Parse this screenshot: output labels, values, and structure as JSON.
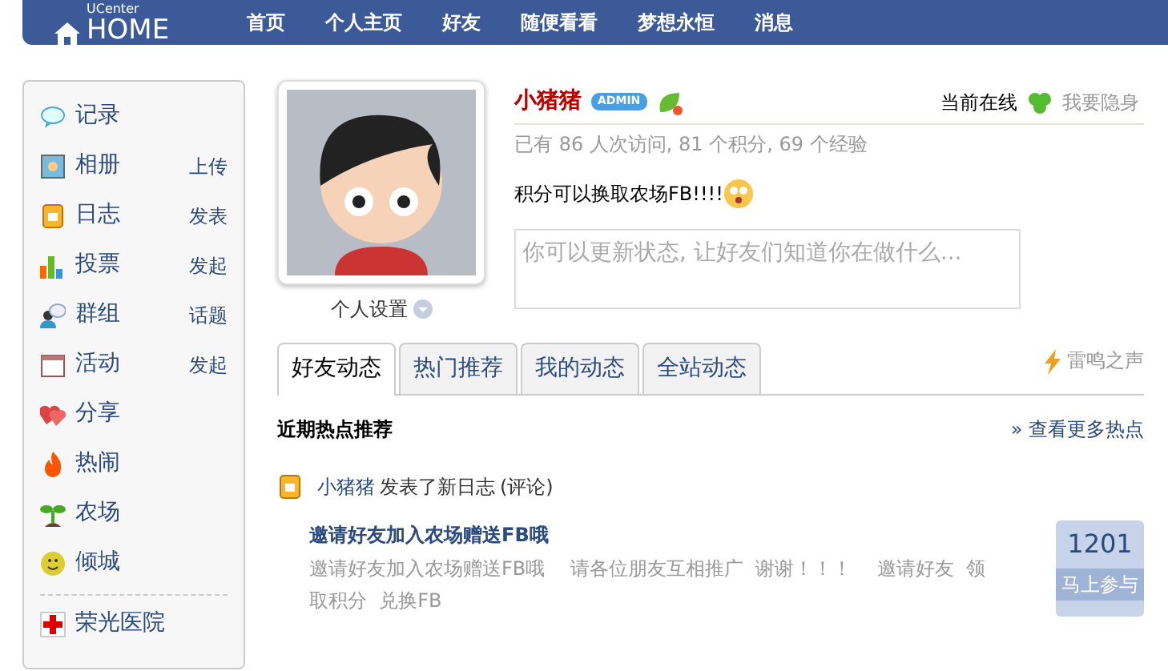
{
  "header": {
    "logo_small": "UCenter",
    "logo": "HOME",
    "nav": [
      {
        "label": "首页"
      },
      {
        "label": "个人主页"
      },
      {
        "label": "好友"
      },
      {
        "label": "随便看看"
      },
      {
        "label": "梦想永恒"
      },
      {
        "label": "消息"
      }
    ]
  },
  "sidebar": {
    "items": [
      {
        "kind": "record",
        "label": "记录"
      },
      {
        "kind": "album",
        "label": "相册",
        "action": "上传"
      },
      {
        "kind": "blog",
        "label": "日志",
        "action": "发表"
      },
      {
        "kind": "poll",
        "label": "投票",
        "action": "发起"
      },
      {
        "kind": "group",
        "label": "群组",
        "action": "话题"
      },
      {
        "kind": "event",
        "label": "活动",
        "action": "发起"
      },
      {
        "kind": "share",
        "label": "分享"
      },
      {
        "kind": "hot",
        "label": "热闹"
      },
      {
        "kind": "farm",
        "label": "农场"
      },
      {
        "kind": "city",
        "label": "倾城"
      },
      {
        "kind": "hospital",
        "label": "荣光医院"
      }
    ]
  },
  "profile": {
    "settings": "个人设置",
    "name": "小猪猪",
    "badge": "ADMIN",
    "online": "当前在线",
    "hide": "我要隐身",
    "stats": "已有  86 人次访问, 81 个积分, 69 个经验",
    "status": "积分可以换取农场FB!!!!",
    "status_input": {
      "placeholder": "你可以更新状态, 让好友们知道你在做什么..."
    }
  },
  "tabs": [
    {
      "label": "好友动态",
      "selected": true
    },
    {
      "label": "热门推荐",
      "selected": false
    },
    {
      "label": "我的动态",
      "selected": false
    },
    {
      "label": "全站动态",
      "selected": false
    }
  ],
  "tabs_link": "雷鸣之声",
  "hot": {
    "title": "近期热点推荐",
    "more": "» 查看更多热点"
  },
  "feed": [
    {
      "user": "小猪猪",
      "action": "发表了新日志",
      "comment": "(评论)",
      "title": "邀请好友加入农场赠送FB哦",
      "summary": "邀请好友加入农场赠送FB哦　 请各位朋友互相推广  谢谢！！！　 邀请好友  领取积分  兑换FB",
      "count": "1201",
      "join": "马上参与"
    }
  ]
}
